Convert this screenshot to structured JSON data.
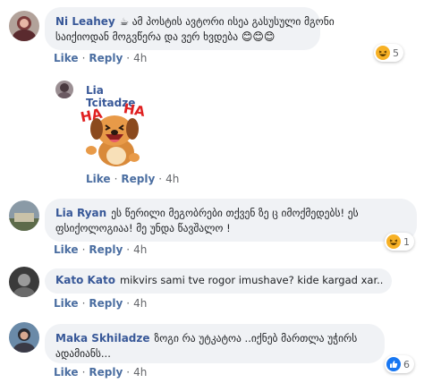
{
  "comments": [
    {
      "author": "Ni Leahey",
      "text_line1": "☕ ამ პოსტის ავტორი ისეა გასუსული მგონი",
      "text_line2": "საიქიოდან მოგვწერა და ვერ ხვდება",
      "like": "Like",
      "reply": "Reply",
      "time": "4h",
      "reaction_count": "5"
    },
    {
      "author": "Lia Tcitadze",
      "sticker_text_left": "HA",
      "sticker_text_right": "HA",
      "like": "Like",
      "reply": "Reply",
      "time": "4h"
    },
    {
      "author": "Lia Ryan",
      "text_line1": "ეს წერილი მეგობრები თქვენ ზე ც იმოქმედებს! ეს",
      "text_line2": "ფსიქოლოგიაა! მე უნდა წავშალო !",
      "like": "Like",
      "reply": "Reply",
      "time": "4h",
      "reaction_count": "1"
    },
    {
      "author": "Kato Kato",
      "text_line1": "mikvirs sami tve rogor imushave? kide kargad xar..",
      "like": "Like",
      "reply": "Reply",
      "time": "4h"
    },
    {
      "author": "Maka Skhiladze",
      "text_line1": "ზოგი რა უტკატოა ..იქნებ მართლა უჭირს",
      "text_line2": "ადამიანს...",
      "like": "Like",
      "reply": "Reply",
      "time": "4h",
      "reaction_count": "6"
    }
  ],
  "separator": "·",
  "colors": {
    "author": "#385898",
    "bubble": "#f0f2f5",
    "like_blue": "#1877f2",
    "haha_yellow": "#f7b125"
  }
}
